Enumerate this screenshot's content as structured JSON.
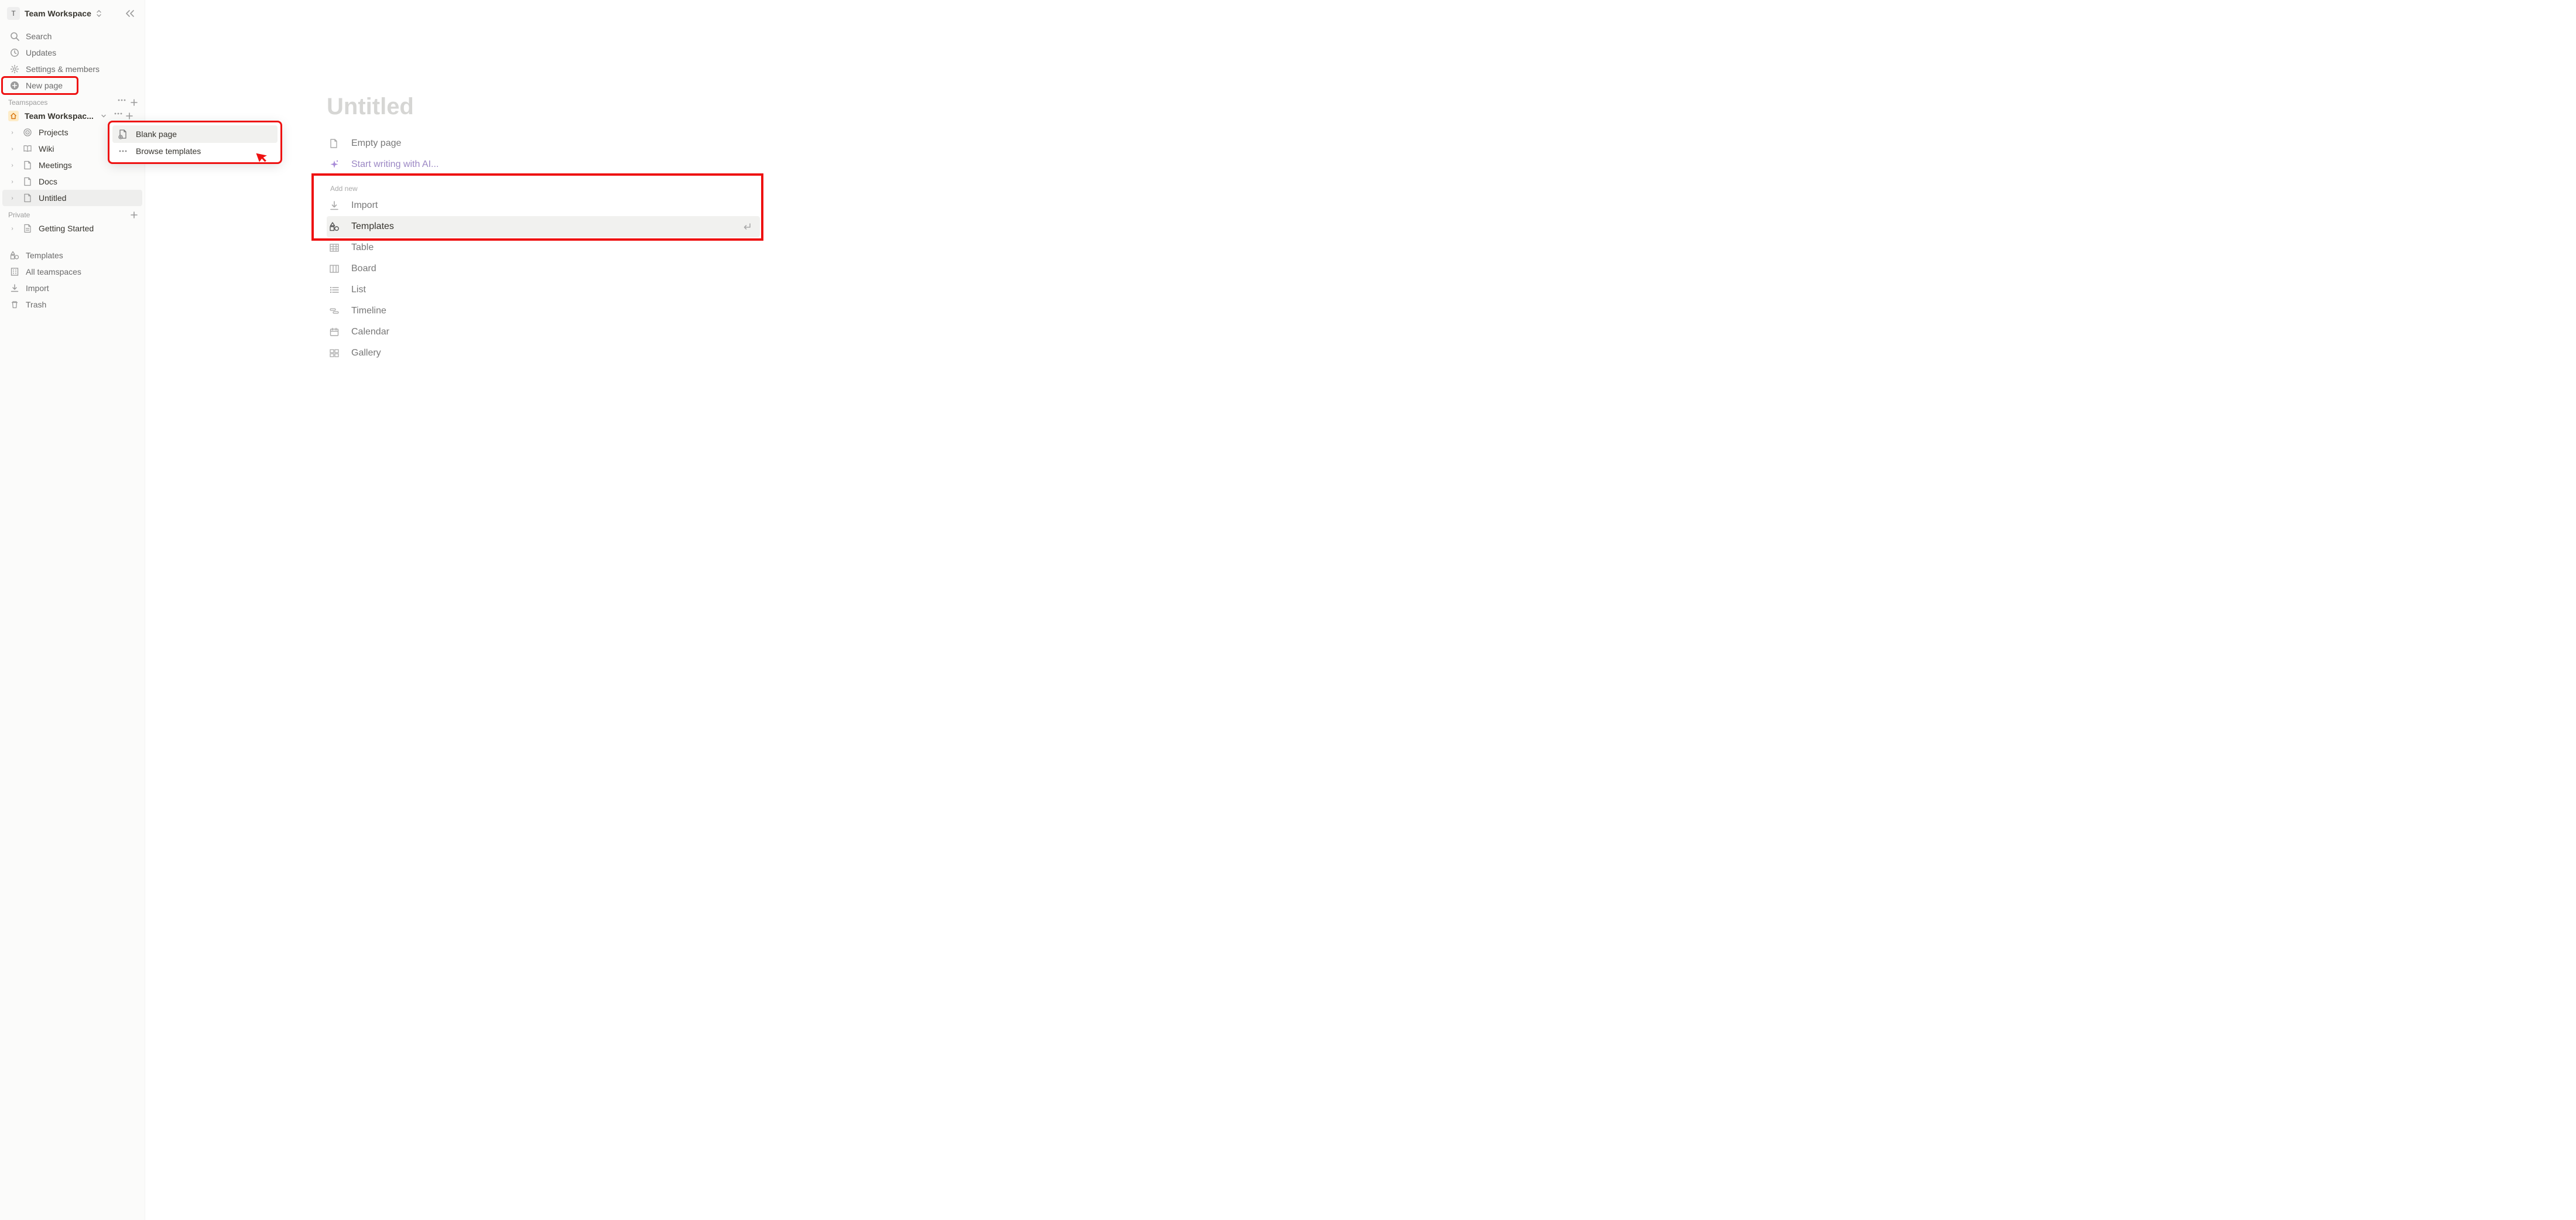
{
  "workspace": {
    "badge": "T",
    "name": "Team Workspace"
  },
  "nav": {
    "search": "Search",
    "updates": "Updates",
    "settings": "Settings & members",
    "new_page": "New page"
  },
  "sections": {
    "teamspaces": "Teamspaces",
    "private": "Private"
  },
  "teamspace": {
    "name": "Team Workspac...",
    "items": [
      {
        "icon": "target",
        "label": "Projects"
      },
      {
        "icon": "book",
        "label": "Wiki"
      },
      {
        "icon": "page",
        "label": "Meetings"
      },
      {
        "icon": "page",
        "label": "Docs"
      },
      {
        "icon": "page",
        "label": "Untitled",
        "selected": true
      }
    ]
  },
  "private": {
    "items": [
      {
        "icon": "page",
        "label": "Getting Started"
      }
    ]
  },
  "bottom": {
    "templates": "Templates",
    "all_teamspaces": "All teamspaces",
    "import": "Import",
    "trash": "Trash"
  },
  "popup": {
    "blank": "Blank page",
    "browse": "Browse templates"
  },
  "page": {
    "title": "Untitled",
    "empty": "Empty page",
    "ai": "Start writing with AI...",
    "add_new": "Add new",
    "options": [
      {
        "key": "import",
        "label": "Import",
        "icon": "download"
      },
      {
        "key": "templates",
        "label": "Templates",
        "icon": "shapes",
        "hover": true
      },
      {
        "key": "table",
        "label": "Table",
        "icon": "table"
      },
      {
        "key": "board",
        "label": "Board",
        "icon": "board"
      },
      {
        "key": "list",
        "label": "List",
        "icon": "list"
      },
      {
        "key": "timeline",
        "label": "Timeline",
        "icon": "timeline"
      },
      {
        "key": "calendar",
        "label": "Calendar",
        "icon": "calendar"
      },
      {
        "key": "gallery",
        "label": "Gallery",
        "icon": "gallery"
      }
    ]
  }
}
